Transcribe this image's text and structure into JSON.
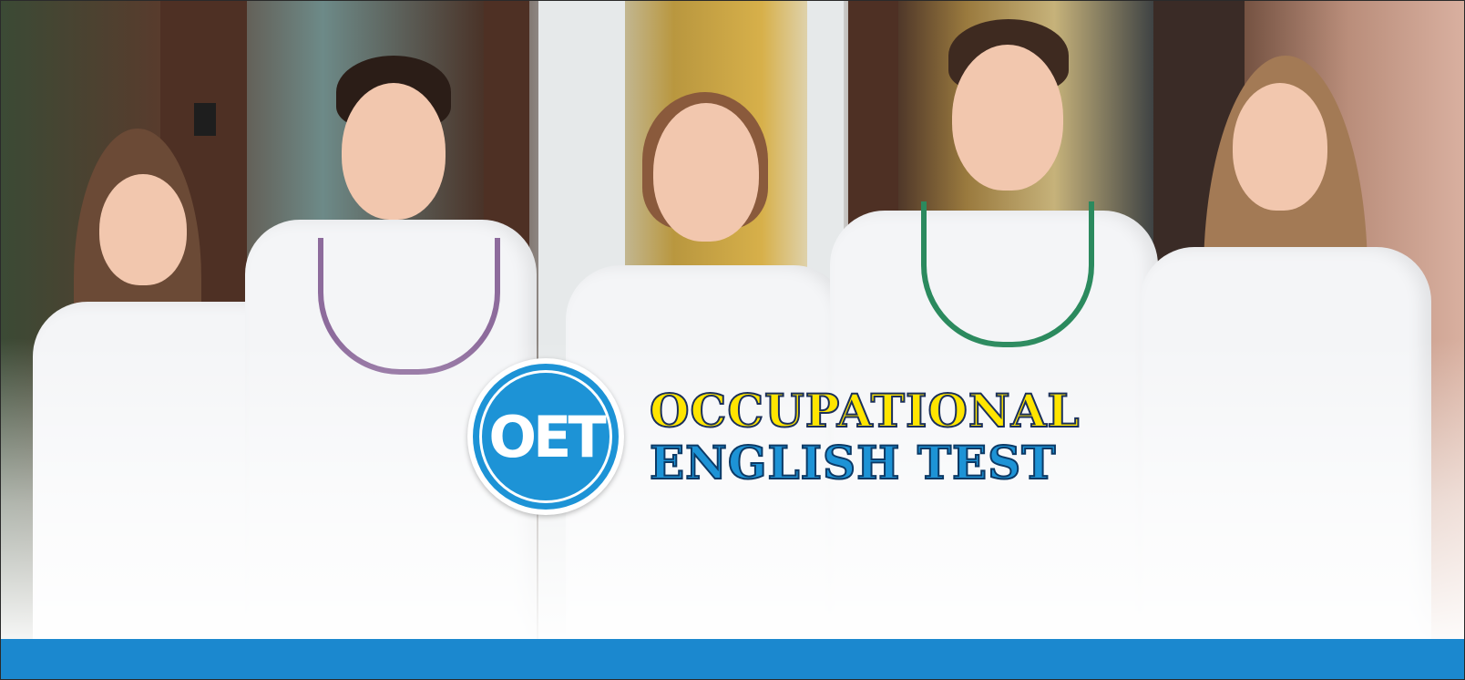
{
  "logo": {
    "text": "OET",
    "color": "#1d93d6"
  },
  "headline": {
    "line1": "OCCUPATIONAL",
    "line2": "ENGLISH TEST",
    "line1_color": "#ffe500",
    "line2_color": "#1d93d6"
  },
  "footer_bar": {
    "color": "#1b88cf"
  },
  "photo": {
    "icon": "medical-students-photo"
  }
}
